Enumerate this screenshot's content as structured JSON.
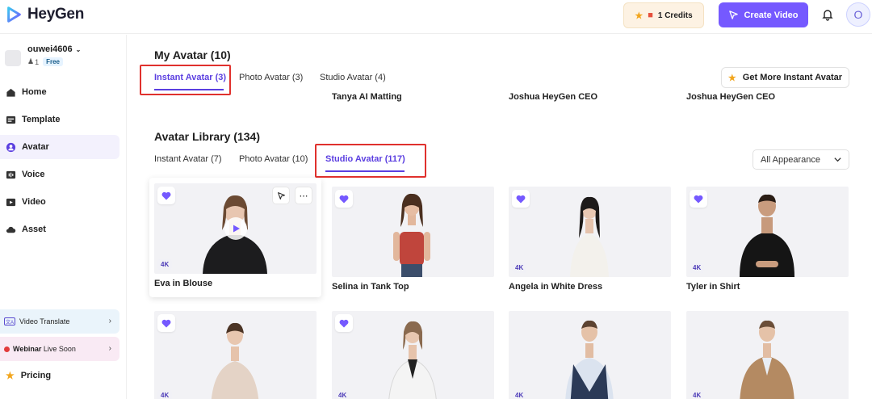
{
  "app": {
    "name": "HeyGen"
  },
  "header": {
    "credits_label": "1 Credits",
    "create_label": "Create Video",
    "avatar_letter": "O"
  },
  "user": {
    "name": "ouwei4606",
    "members": "1",
    "plan": "Free"
  },
  "nav": [
    {
      "label": "Home",
      "icon": "home-icon"
    },
    {
      "label": "Template",
      "icon": "template-icon"
    },
    {
      "label": "Avatar",
      "icon": "avatar-icon",
      "active": true
    },
    {
      "label": "Voice",
      "icon": "voice-icon"
    },
    {
      "label": "Video",
      "icon": "video-icon"
    },
    {
      "label": "Asset",
      "icon": "cloud-icon"
    }
  ],
  "promos": {
    "video_translate": "Video Translate",
    "webinar_bold": "Webinar",
    "webinar_rest": "Live Soon"
  },
  "pricing_label": "Pricing",
  "my_avatar": {
    "title": "My Avatar (10)",
    "tabs": [
      "Instant Avatar (3)",
      "Photo Avatar (3)",
      "Studio Avatar (4)"
    ],
    "get_more_label": "Get More Instant Avatar",
    "peek_names": [
      "Tanya AI Matting",
      "Joshua HeyGen CEO",
      "Joshua HeyGen CEO"
    ]
  },
  "library": {
    "title": "Avatar Library (134)",
    "tabs": [
      "Instant Avatar (7)",
      "Photo Avatar (10)",
      "Studio Avatar (117)"
    ],
    "appearance": "All Appearance",
    "badge": "4K",
    "cards": [
      "Eva in Blouse",
      "Selina in Tank Top",
      "Angela in White Dress",
      "Tyler in Shirt"
    ]
  }
}
